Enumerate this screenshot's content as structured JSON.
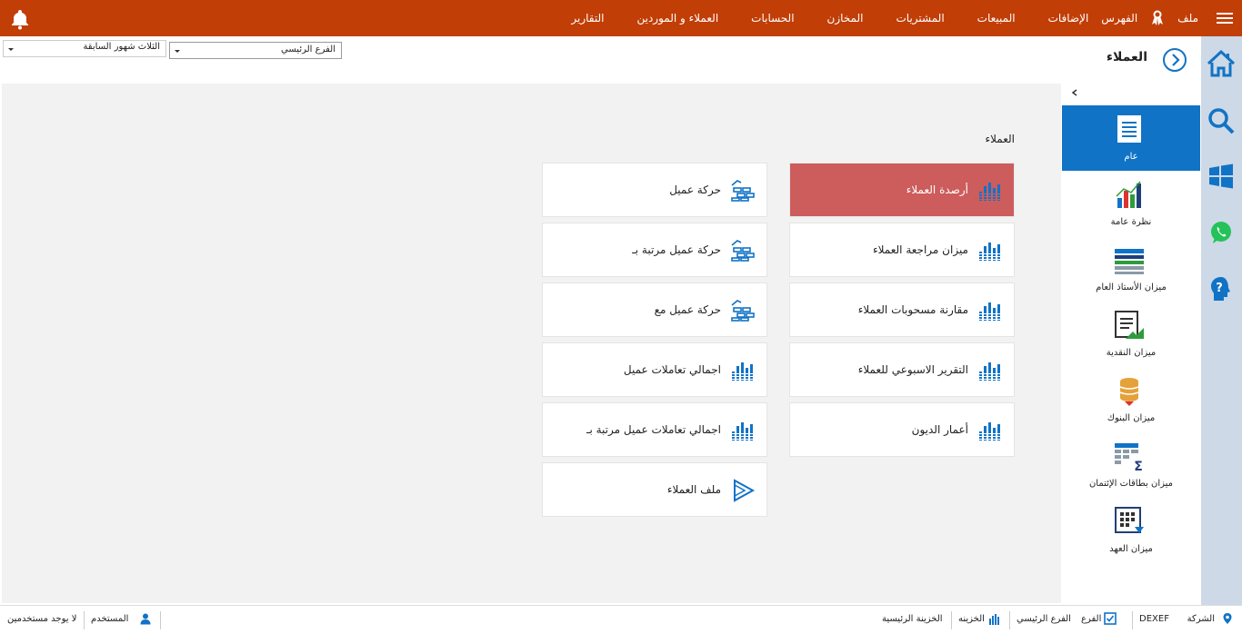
{
  "menu": {
    "items": [
      "ملف",
      "الفهرس",
      "الإضافات",
      "المبيعات",
      "المشتريات",
      "المخازن",
      "الحسابات",
      "العملاء و الموردين",
      "التقارير"
    ]
  },
  "filters": {
    "branch": "الفرع الرئيسي",
    "period": "الثلاث شهور السابقة"
  },
  "panel": {
    "title": "العملاء"
  },
  "sidebar": {
    "items": [
      {
        "label": "عام",
        "icon": "document-list-icon",
        "active": true
      },
      {
        "label": "نظرة عامة",
        "icon": "bar-chart-icon"
      },
      {
        "label": "ميزان الأستاذ العام",
        "icon": "ledger-table-icon"
      },
      {
        "label": "ميزان النقدية",
        "icon": "cash-report-icon"
      },
      {
        "label": "ميزان البنوك",
        "icon": "bank-coins-icon"
      },
      {
        "label": "ميزان بطاقات الإئتمان",
        "icon": "credit-sum-icon"
      },
      {
        "label": "ميزان العهد",
        "icon": "custody-grid-icon"
      }
    ]
  },
  "main": {
    "section_title": "العملاء",
    "cards": [
      {
        "label": "أرصدة العملاء",
        "icon": "report-bars-icon",
        "selected": true
      },
      {
        "label": "حركة عميل",
        "icon": "client-movement-icon"
      },
      {
        "label": "ميزان مراجعة العملاء",
        "icon": "report-bars-icon"
      },
      {
        "label": "حركة عميل مرتبة بـ",
        "icon": "client-movement-icon"
      },
      {
        "label": "مقارنة مسحوبات العملاء",
        "icon": "report-bars-icon"
      },
      {
        "label": "حركة عميل مع",
        "icon": "client-movement-icon"
      },
      {
        "label": "التقرير الاسبوعي للعملاء",
        "icon": "report-bars-icon"
      },
      {
        "label": "اجمالي تعاملات عميل",
        "icon": "report-bars-icon"
      },
      {
        "label": "أعمار الديون",
        "icon": "report-bars-icon"
      },
      {
        "label": "اجمالي تعاملات عميل مرتبة بـ",
        "icon": "report-bars-icon"
      },
      {
        "label": "ملف العملاء",
        "icon": "play-file-icon"
      }
    ]
  },
  "status": {
    "company_label": "الشركة",
    "company_value": "DEXEF",
    "branch_label": "الفرع",
    "branch_value": "الفرع الرئيسي",
    "treasury_label": "الخزينه",
    "treasury_value": "الخزينة الرئيسية",
    "user_label": "المستخدم",
    "user_value": "لا يوجد مستخدمين"
  },
  "colors": {
    "topbar": "#c13e06",
    "accent_blue": "#1173c6",
    "selected_card": "#cd5c5c",
    "rail": "#cdd9e6",
    "main_bg": "#f2f2f2"
  }
}
